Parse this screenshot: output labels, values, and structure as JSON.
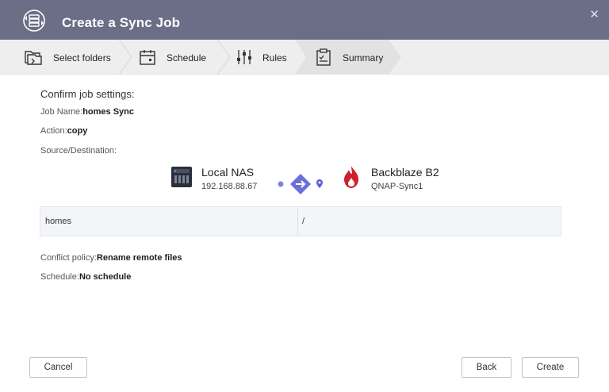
{
  "window": {
    "title": "Create a Sync Job",
    "close_label": "✕"
  },
  "steps": [
    {
      "label": "Select folders",
      "icon": "folders-icon",
      "active": false
    },
    {
      "label": "Schedule",
      "icon": "calendar-icon",
      "active": false
    },
    {
      "label": "Rules",
      "icon": "sliders-icon",
      "active": false
    },
    {
      "label": "Summary",
      "icon": "clipboard-icon",
      "active": true
    }
  ],
  "summary": {
    "heading": "Confirm job settings:",
    "job_name_label": "Job Name:",
    "job_name": "homes Sync",
    "action_label": "Action:",
    "action": "copy",
    "source_dest_label": "Source/Destination:",
    "conflict_label": "Conflict policy:",
    "conflict": "Rename remote files",
    "schedule_label": "Schedule:",
    "schedule": "No schedule"
  },
  "source": {
    "name": "Local NAS",
    "address": "192.168.88.67",
    "icon": "nas-icon"
  },
  "destination": {
    "name": "Backblaze B2",
    "account": "QNAP-Sync1",
    "icon": "backblaze-flame-icon"
  },
  "paths": {
    "source_path": "homes",
    "destination_path": "/"
  },
  "buttons": {
    "cancel": "Cancel",
    "back": "Back",
    "create": "Create"
  },
  "colors": {
    "titlebar": "#6b6e86",
    "accent": "#6b6fd9",
    "backblaze": "#d0202e"
  }
}
